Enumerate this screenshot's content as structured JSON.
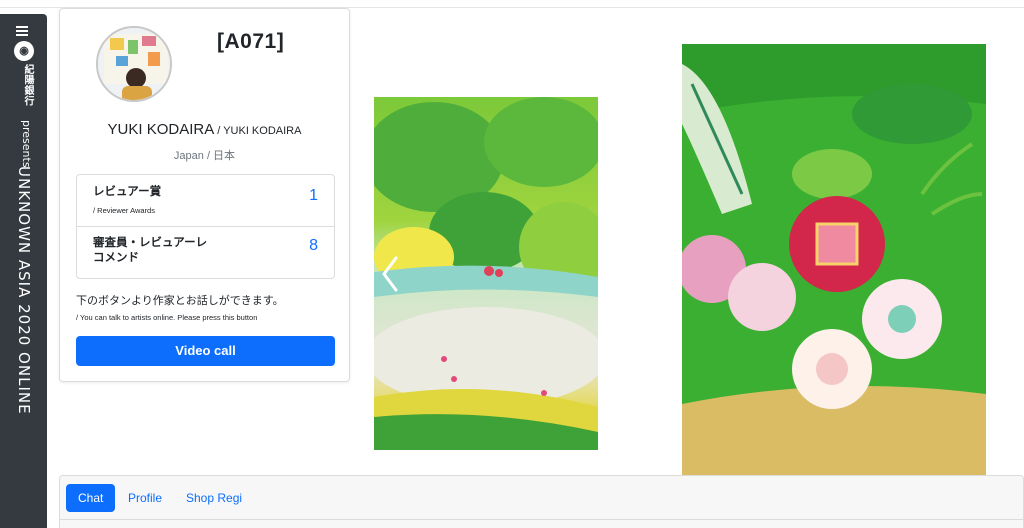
{
  "sidebar": {
    "menu_icon": "hamburger-icon",
    "logo_icon": "unknown-asia-logo-icon",
    "brand": "紀陽銀行",
    "presents": "presents",
    "event_title": "UNKNOWN ASIA 2020 ONLINE"
  },
  "artist": {
    "code": "[A071]",
    "name_en": "YUKI KODAIRA",
    "name_sub": " / YUKI KODAIRA",
    "country": "Japan / 日本"
  },
  "awards": [
    {
      "title": "レビュアー賞",
      "subtitle": "/ Reviewer Awards",
      "count": "1"
    },
    {
      "title": "審査員・レビュアーレコメンド",
      "subtitle": "",
      "count": "8"
    }
  ],
  "talk": {
    "jp": "下のボタンより作家とお話しができます。",
    "en": "/ You can talk to artists online. Please press this button",
    "button_label": "Video call"
  },
  "tabs": [
    {
      "label": "Chat",
      "active": true
    },
    {
      "label": "Profile",
      "active": false
    },
    {
      "label": "Shop Regi",
      "active": false
    }
  ],
  "colors": {
    "accent": "#0d6efd",
    "sidebar": "#343a40",
    "art_green": "#3cb02e"
  }
}
